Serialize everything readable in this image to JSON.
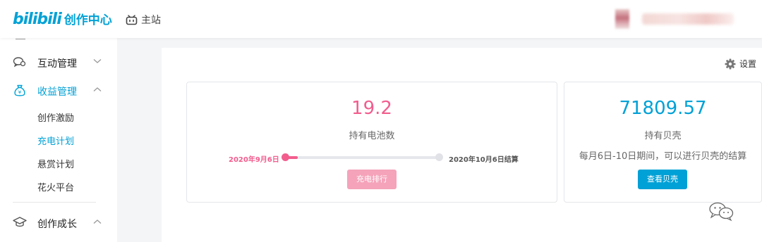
{
  "header": {
    "brand": "bilibili",
    "brand_sub": "创作中心",
    "home_label": "主站",
    "home_icon": "tv-icon"
  },
  "sidebar": {
    "groups": [
      {
        "label": "互动管理",
        "icon": "chat-bubble-icon",
        "expanded": false,
        "active": false
      },
      {
        "label": "收益管理",
        "icon": "money-bag-icon",
        "expanded": true,
        "active": true,
        "items": [
          {
            "label": "创作激励",
            "active": false
          },
          {
            "label": "充电计划",
            "active": true
          },
          {
            "label": "悬赏计划",
            "active": false
          },
          {
            "label": "花火平台",
            "active": false
          }
        ]
      },
      {
        "label": "创作成长",
        "icon": "graduation-cap-icon",
        "expanded": true,
        "active": false
      }
    ]
  },
  "main": {
    "settings_label": "设置",
    "battery_card": {
      "value": "19.2",
      "label": "持有电池数",
      "period_start": "2020年9月6日",
      "period_end": "2020年10月6日结算",
      "progress": 0.08,
      "button_label": "充电排行"
    },
    "shell_card": {
      "value": "71809.57",
      "label": "持有贝壳",
      "note": "每月6日-10日期间，可以进行贝壳的结算",
      "button_label": "查看贝壳"
    }
  },
  "colors": {
    "brand_blue": "#00a1d6",
    "accent_pink": "#f25d8e",
    "button_pink": "#f5a3ba",
    "page_bg": "#f4f5f7"
  }
}
